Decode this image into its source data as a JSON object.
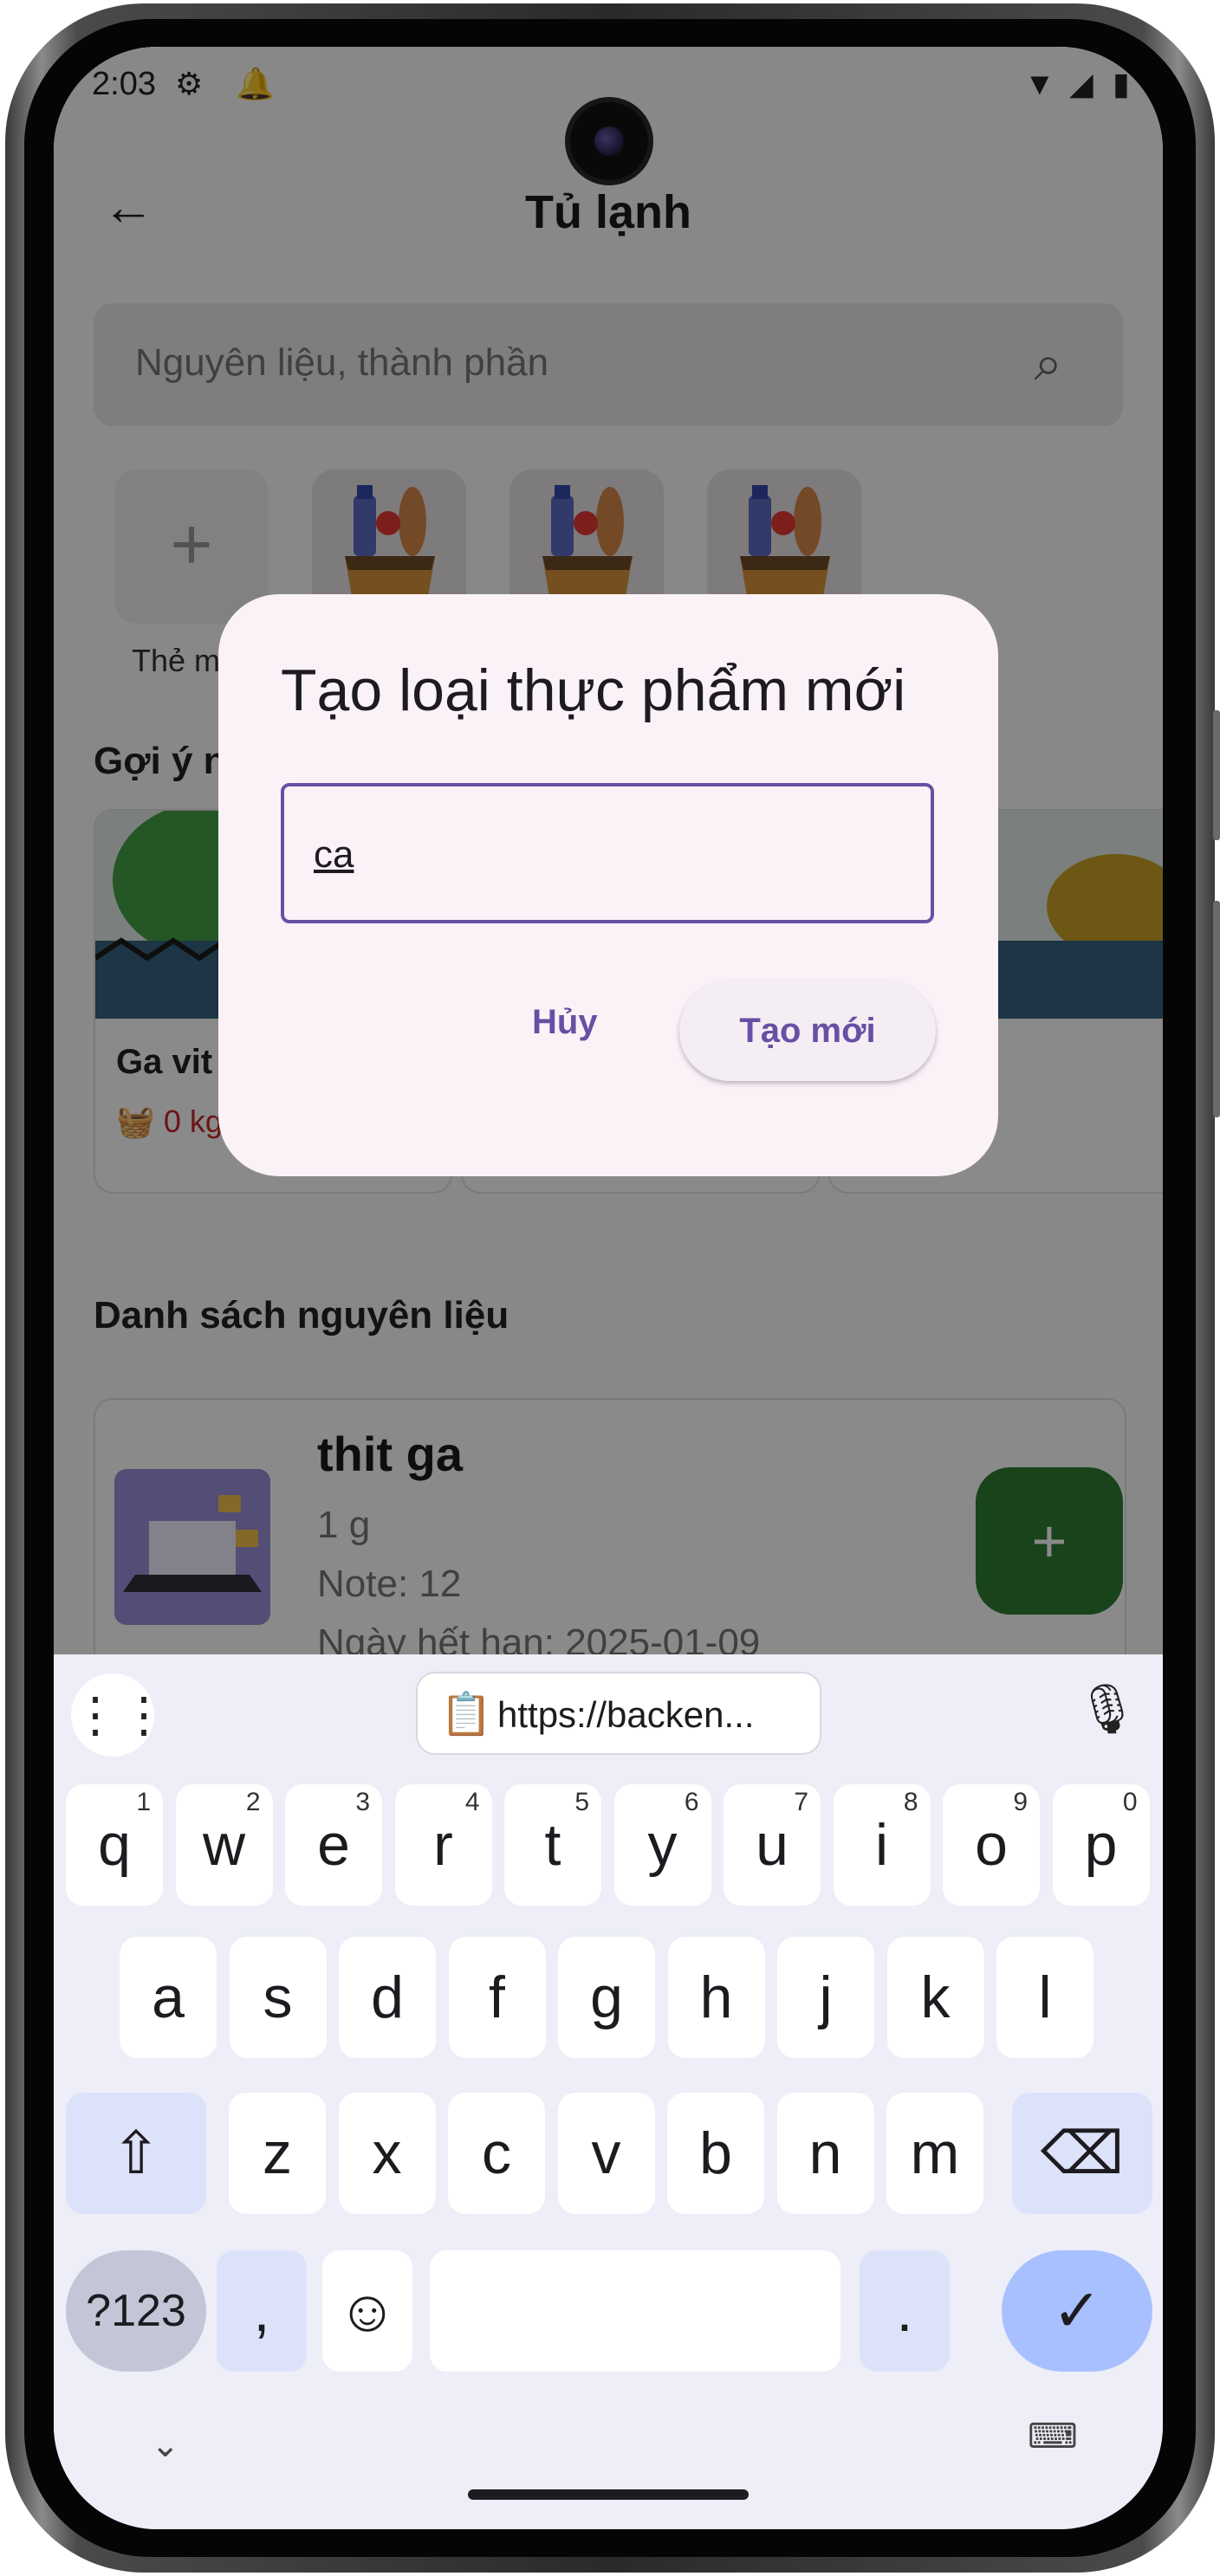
{
  "status": {
    "time": "2:03"
  },
  "appbar": {
    "title": "Tủ lạnh"
  },
  "search": {
    "placeholder": "Nguyên liệu, thành phần"
  },
  "categories": {
    "add_label": "Thẻ m"
  },
  "suggestions": {
    "heading": "Gợi ý n",
    "items": [
      {
        "name": "Ga vit",
        "qty": "0 kg"
      }
    ]
  },
  "ingredients": {
    "heading": "Danh sách nguyên liệu",
    "items": [
      {
        "name": "thit ga",
        "qty": "1 g",
        "note": "Note: 12",
        "expiry": "Ngày hết hạn: 2025-01-09"
      }
    ]
  },
  "dialog": {
    "title": "Tạo loại thực phẩm mới",
    "input_value": "ca",
    "cancel_label": "Hủy",
    "create_label": "Tạo mới"
  },
  "keyboard": {
    "clipboard_text": "https://backen...",
    "row1": [
      {
        "k": "q",
        "h": "1"
      },
      {
        "k": "w",
        "h": "2"
      },
      {
        "k": "e",
        "h": "3"
      },
      {
        "k": "r",
        "h": "4"
      },
      {
        "k": "t",
        "h": "5"
      },
      {
        "k": "y",
        "h": "6"
      },
      {
        "k": "u",
        "h": "7"
      },
      {
        "k": "i",
        "h": "8"
      },
      {
        "k": "o",
        "h": "9"
      },
      {
        "k": "p",
        "h": "0"
      }
    ],
    "row2": [
      "a",
      "s",
      "d",
      "f",
      "g",
      "h",
      "j",
      "k",
      "l"
    ],
    "row3": [
      "z",
      "x",
      "c",
      "v",
      "b",
      "n",
      "m"
    ],
    "symbols_label": "?123",
    "comma": ",",
    "period": "."
  }
}
